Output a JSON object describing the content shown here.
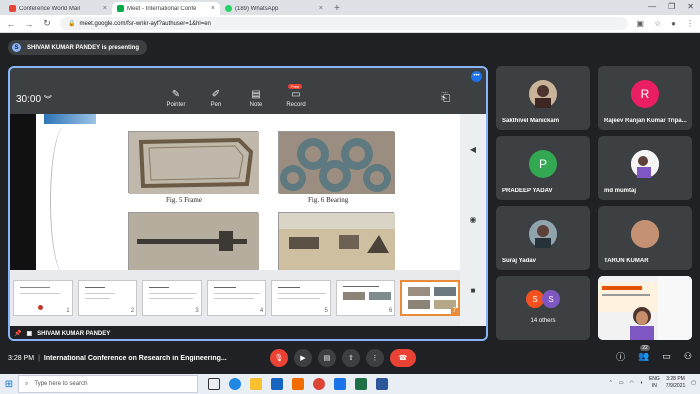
{
  "browser": {
    "tabs": [
      {
        "title": "Conference World Mail",
        "color": "#ea4335"
      },
      {
        "title": "Meet - International Confe",
        "color": "#00ac47"
      },
      {
        "title": "(189) WhatsApp",
        "color": "#25d366"
      }
    ],
    "newtab": "+",
    "url": "meet.google.com/fsr-wnkr-ayf?authuser=1&hl=en"
  },
  "presenting_banner": "SHIVAM KUMAR PANDEY is presenting",
  "presenter_toolbar": {
    "timer": "30:00",
    "tools": [
      {
        "label": "Pointer",
        "icon": "pointer-icon"
      },
      {
        "label": "Pen",
        "icon": "pen-icon"
      },
      {
        "label": "Note",
        "icon": "note-icon"
      },
      {
        "label": "Record",
        "icon": "record-icon",
        "badge": "Free"
      }
    ]
  },
  "slide": {
    "captions": [
      "Fig. 5 Frame",
      "Fig. 6 Bearing"
    ],
    "thumbnail_numbers": [
      "1",
      "2",
      "3",
      "4",
      "5",
      "6",
      "7"
    ],
    "selected_thumbnail": "7"
  },
  "presenter_name": "SHIVAM KUMAR PANDEY",
  "participants": [
    {
      "name": "Sakthivel Manickam",
      "initial": "",
      "color": "#6d4c41"
    },
    {
      "name": "Rajeev Ranjan Kumar Tripa...",
      "initial": "R",
      "color": "#e91e63"
    },
    {
      "name": "PRADEEP YADAV",
      "initial": "P",
      "color": "#33a852"
    },
    {
      "name": "md mumtaj",
      "initial": "",
      "color": "#eeeeee"
    },
    {
      "name": "Suraj Yadav",
      "initial": "",
      "color": "#546e7a"
    },
    {
      "name": "TARUN KUMAR",
      "initial": "",
      "color": "#c08a6a"
    }
  ],
  "others": {
    "label": "14 others",
    "initials": [
      "S",
      "S"
    ],
    "colors": [
      "#f4511e",
      "#7e57c2"
    ]
  },
  "bottom_bar": {
    "time": "3:28 PM",
    "separator": "|",
    "title": "International Conference on Research in Engineering...",
    "participant_count": "22"
  },
  "taskbar": {
    "search_placeholder": "Type here to search",
    "lang": "ENG",
    "region": "IN",
    "time": "3:28 PM",
    "date": "7/9/2021"
  }
}
